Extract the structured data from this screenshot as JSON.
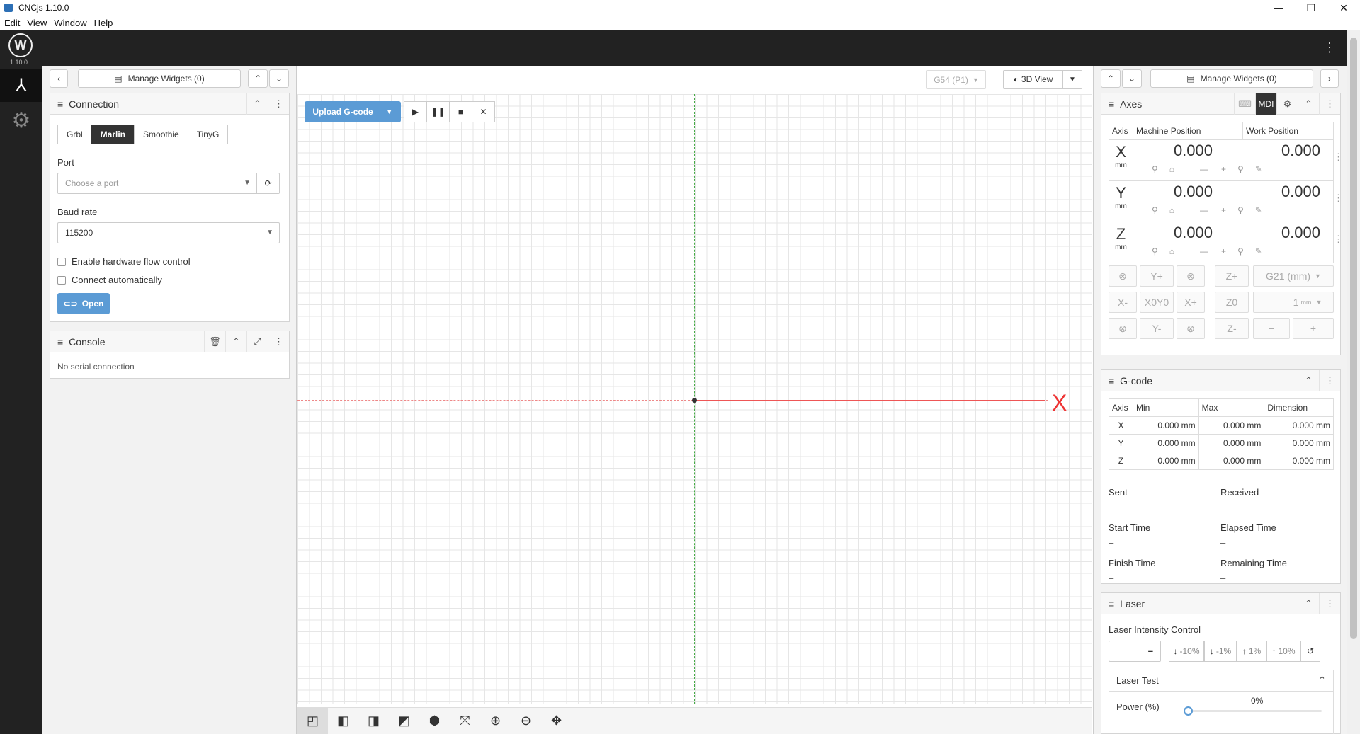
{
  "window": {
    "title": "CNCjs 1.10.0",
    "controls": {
      "minimize": "—",
      "maximize": "❐",
      "close": "✕"
    }
  },
  "menu": [
    "Edit",
    "View",
    "Window",
    "Help"
  ],
  "app": {
    "version": "1.10.0"
  },
  "left": {
    "manage_widgets": "Manage Widgets (0)",
    "connection": {
      "title": "Connection",
      "controllers": [
        "Grbl",
        "Marlin",
        "Smoothie",
        "TinyG"
      ],
      "active_controller": "Marlin",
      "port_label": "Port",
      "port_placeholder": "Choose a port",
      "baud_label": "Baud rate",
      "baud_value": "115200",
      "hw_flow": "Enable hardware flow control",
      "auto_connect": "Connect automatically",
      "open": "Open"
    },
    "console": {
      "title": "Console",
      "message": "No serial connection"
    }
  },
  "center": {
    "upload": "Upload G-code",
    "wcs": "G54 (P1)",
    "view": "3D View",
    "x_label": "X"
  },
  "right": {
    "manage_widgets": "Manage Widgets (0)",
    "axes": {
      "title": "Axes",
      "mdi": "MDI",
      "headers": [
        "Axis",
        "Machine Position",
        "Work Position"
      ],
      "rows": [
        {
          "axis": "X",
          "unit": "mm",
          "machine": "0.000",
          "work": "0.000"
        },
        {
          "axis": "Y",
          "unit": "mm",
          "machine": "0.000",
          "work": "0.000"
        },
        {
          "axis": "Z",
          "unit": "mm",
          "machine": "0.000",
          "work": "0.000"
        }
      ],
      "jog": {
        "y_plus": "Y+",
        "z_plus": "Z+",
        "units": "G21 (mm)",
        "x_minus": "X-",
        "x0y0": "X0Y0",
        "x_plus": "X+",
        "z0": "Z0",
        "step": "1",
        "step_unit": "mm",
        "y_minus": "Y-",
        "z_minus": "Z-",
        "minus": "−",
        "plus": "+"
      }
    },
    "gcode": {
      "title": "G-code",
      "headers": [
        "Axis",
        "Min",
        "Max",
        "Dimension"
      ],
      "rows": [
        {
          "axis": "X",
          "min": "0.000 mm",
          "max": "0.000 mm",
          "dim": "0.000 mm"
        },
        {
          "axis": "Y",
          "min": "0.000 mm",
          "max": "0.000 mm",
          "dim": "0.000 mm"
        },
        {
          "axis": "Z",
          "min": "0.000 mm",
          "max": "0.000 mm",
          "dim": "0.000 mm"
        }
      ],
      "stats": {
        "sent": "Sent",
        "received": "Received",
        "start_time": "Start Time",
        "elapsed_time": "Elapsed Time",
        "finish_time": "Finish Time",
        "remaining_time": "Remaining Time",
        "empty": "–"
      }
    },
    "laser": {
      "title": "Laser",
      "intensity_label": "Laser Intensity Control",
      "intensity_value": "–",
      "steps": [
        "-10%",
        "-1%",
        "1%",
        "10%"
      ],
      "test_title": "Laser Test",
      "power_label": "Power (%)",
      "power_value": "0%"
    }
  }
}
